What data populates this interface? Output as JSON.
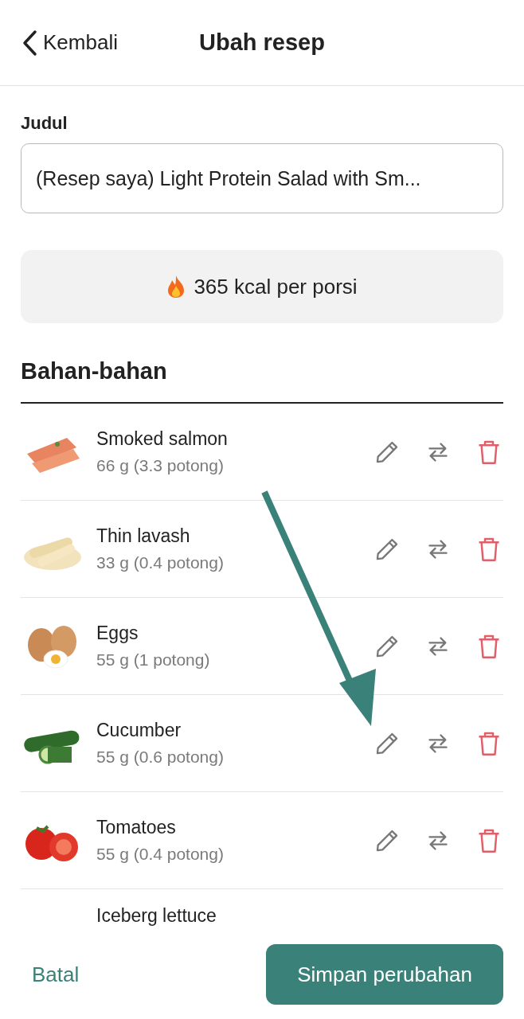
{
  "header": {
    "back_label": "Kembali",
    "title": "Ubah resep"
  },
  "title_field": {
    "label": "Judul",
    "value": "(Resep saya) Light Protein Salad with Sm..."
  },
  "calories": "365 kcal per porsi",
  "ingredients_heading": "Bahan-bahan",
  "ingredients": [
    {
      "name": "Smoked salmon",
      "amount": "66 g (3.3 potong)",
      "kind": "salmon"
    },
    {
      "name": "Thin lavash",
      "amount": "33 g (0.4 potong)",
      "kind": "lavash"
    },
    {
      "name": "Eggs",
      "amount": "55 g (1 potong)",
      "kind": "eggs"
    },
    {
      "name": "Cucumber",
      "amount": "55 g (0.6 potong)",
      "kind": "cucumber"
    },
    {
      "name": "Tomatoes",
      "amount": "55 g (0.4 potong)",
      "kind": "tomatoes"
    },
    {
      "name": "Iceberg lettuce"
    }
  ],
  "footer": {
    "cancel": "Batal",
    "save": "Simpan perubahan"
  }
}
